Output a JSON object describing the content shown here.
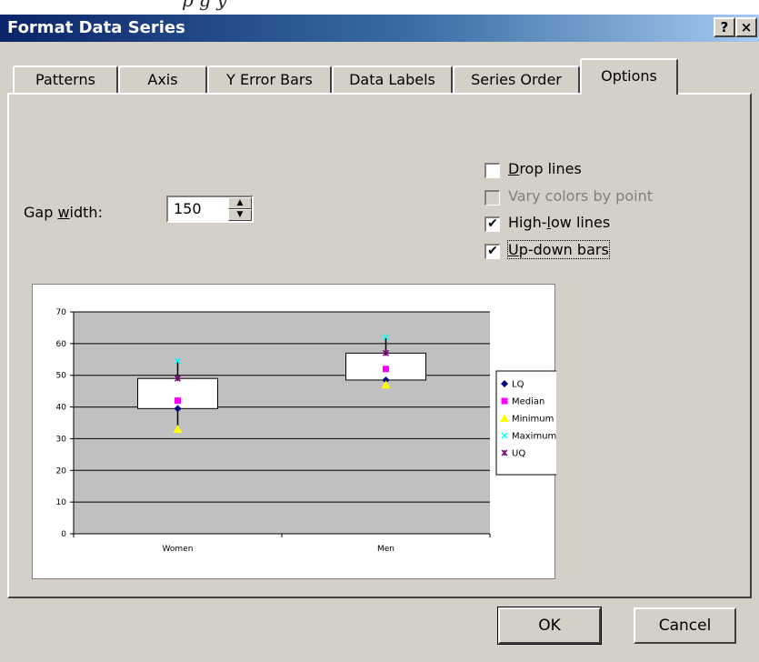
{
  "top_fragment": "p                    g                             y",
  "dialog": {
    "title": "Format Data Series",
    "help_btn": "?",
    "close_btn": "×"
  },
  "tabs": [
    {
      "label": "Patterns"
    },
    {
      "label": "Axis"
    },
    {
      "label": "Y Error Bars"
    },
    {
      "label": "Data Labels"
    },
    {
      "label": "Series Order"
    },
    {
      "label": "Options"
    }
  ],
  "options": {
    "gap_width_label_pre": "Gap ",
    "gap_width_label_u": "w",
    "gap_width_label_post": "idth:",
    "gap_width_value": "150",
    "checkboxes": [
      {
        "pre": "",
        "u": "D",
        "post": "rop lines",
        "checked": false,
        "disabled": false
      },
      {
        "pre": "Vary colors by point",
        "u": "",
        "post": "",
        "checked": false,
        "disabled": true
      },
      {
        "pre": "High-",
        "u": "l",
        "post": "ow lines",
        "checked": true,
        "disabled": false
      },
      {
        "pre": "",
        "u": "U",
        "post": "p-down bars",
        "checked": true,
        "disabled": false
      }
    ]
  },
  "buttons": {
    "ok": "OK",
    "cancel": "Cancel"
  },
  "chart_data": {
    "type": "stock",
    "categories": [
      "Women",
      "Men"
    ],
    "ylim": [
      0,
      70
    ],
    "yticks": [
      0,
      10,
      20,
      30,
      40,
      50,
      60,
      70
    ],
    "grid": true,
    "plot_bg": "#c0c0c0",
    "legend_position": "right",
    "series": [
      {
        "name": "LQ",
        "values": [
          39.5,
          48.5
        ],
        "color": "#000080",
        "marker": "diamond"
      },
      {
        "name": "Median",
        "values": [
          42,
          52
        ],
        "color": "#ff00ff",
        "marker": "square"
      },
      {
        "name": "Minimum",
        "values": [
          33,
          47
        ],
        "color": "#ffff00",
        "marker": "triangle"
      },
      {
        "name": "Maximum",
        "values": [
          54.5,
          62
        ],
        "color": "#00ffff",
        "marker": "x"
      },
      {
        "name": "UQ",
        "values": [
          49,
          57
        ],
        "color": "#800080",
        "marker": "star"
      }
    ],
    "updown_bars": [
      {
        "category": "Women",
        "low": 39.5,
        "high": 49
      },
      {
        "category": "Men",
        "low": 48.5,
        "high": 57
      }
    ],
    "highlow_lines": [
      {
        "category": "Women",
        "low": 33,
        "high": 54.5
      },
      {
        "category": "Men",
        "low": 47,
        "high": 62
      }
    ]
  }
}
